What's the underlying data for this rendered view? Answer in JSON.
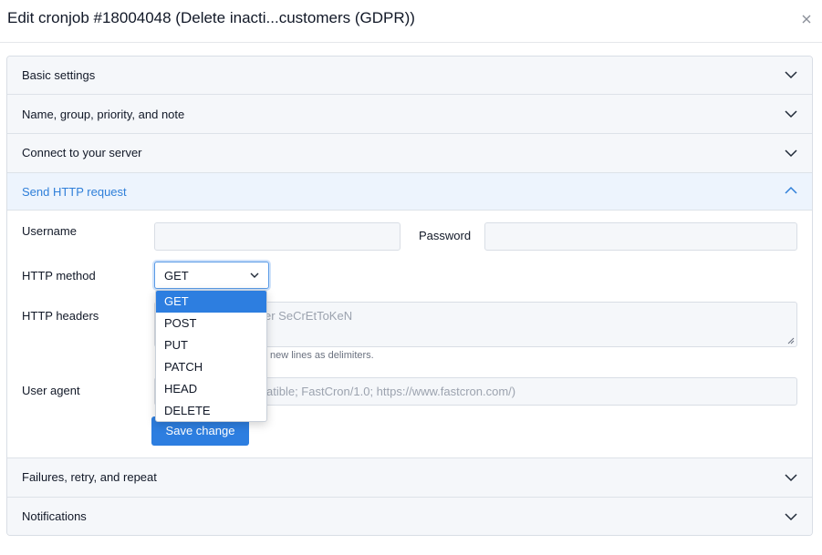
{
  "modal": {
    "title": "Edit cronjob #18004048 (Delete inacti...customers (GDPR))",
    "close_icon": "close-icon"
  },
  "sections": {
    "basic": "Basic settings",
    "name": "Name, group, priority, and note",
    "connect": "Connect to your server",
    "http": "Send HTTP request",
    "failures": "Failures, retry, and repeat",
    "notifications": "Notifications"
  },
  "http_form": {
    "username_label": "Username",
    "username_value": "",
    "password_label": "Password",
    "password_value": "",
    "method_label": "HTTP method",
    "method_value": "GET",
    "method_options": [
      "GET",
      "POST",
      "PUT",
      "PATCH",
      "HEAD",
      "DELETE"
    ],
    "headers_label": "HTTP headers",
    "headers_placeholder_visible": "er SeCrEtToKeN",
    "headers_hint_visible": "new lines as delimiters.",
    "user_agent_label": "User agent",
    "user_agent_placeholder_visible": "atible; FastCron/1.0; https://www.fastcron.com/)",
    "save_label": "Save change"
  },
  "colors": {
    "accent": "#2d7ee0",
    "active_section_bg": "#edf4fd",
    "active_section_text": "#2f7fd9",
    "section_bg": "#f5f7fa"
  },
  "icons": {
    "chevron_down": "chevron-down-icon",
    "chevron_up": "chevron-up-icon",
    "select_caret": "chevron-down-icon",
    "resize_handle": "resize-handle-icon"
  }
}
